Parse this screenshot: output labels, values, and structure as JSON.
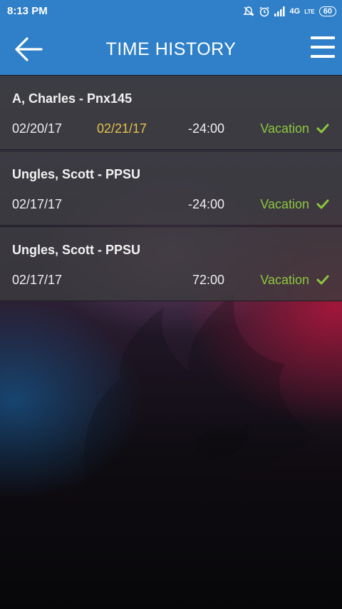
{
  "status_bar": {
    "time": "8:13 PM",
    "network": "4G",
    "volte": "LTE",
    "battery": "60"
  },
  "header": {
    "title": "TIME HISTORY"
  },
  "entries": [
    {
      "name": "A, Charles - Pnx145",
      "start_date": "02/20/17",
      "end_date": "02/21/17",
      "hours": "-24:00",
      "type": "Vacation"
    },
    {
      "name": "Ungles, Scott - PPSU",
      "start_date": "02/17/17",
      "end_date": "",
      "hours": "-24:00",
      "type": "Vacation"
    },
    {
      "name": "Ungles, Scott - PPSU",
      "start_date": "02/17/17",
      "end_date": "",
      "hours": "72:00",
      "type": "Vacation"
    }
  ],
  "colors": {
    "app_bar": "#2f80c8",
    "end_date": "#e6c14a",
    "approved": "#8cc63f"
  },
  "icons": {
    "back": "arrow-left-icon",
    "menu": "hamburger-menu-icon",
    "approved": "checkmark-icon"
  }
}
